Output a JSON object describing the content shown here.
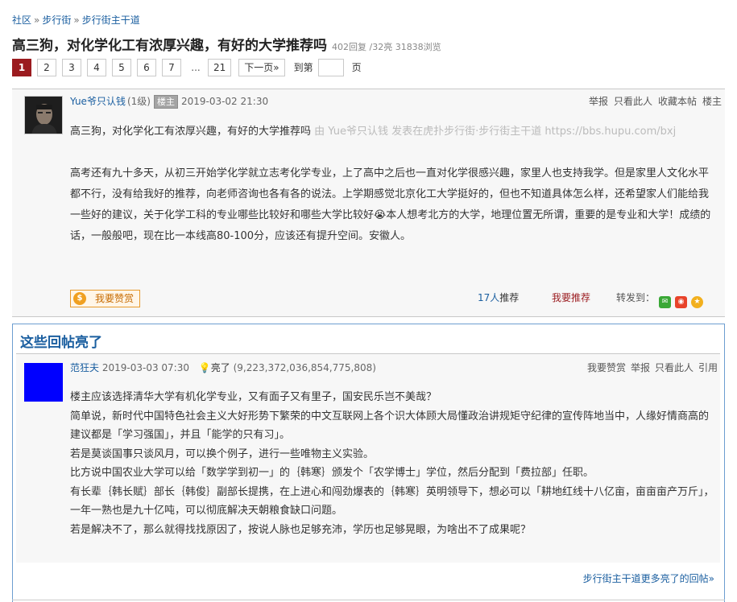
{
  "breadcrumb": {
    "items": [
      "社区",
      "步行街",
      "步行街主干道"
    ],
    "separator": "»"
  },
  "thread": {
    "title": "高三狗，对化学化工有浓厚兴趣，有好的大学推荐吗",
    "stats": "402回复 /32亮  31838浏览"
  },
  "pager": {
    "pages": [
      "1",
      "2",
      "3",
      "4",
      "5",
      "6",
      "7"
    ],
    "ellipsis": "...",
    "last_page": "21",
    "next_label": "下一页»",
    "goto_label": "到第",
    "page_unit": "页",
    "active_page": "1"
  },
  "main_post": {
    "author": "Yue爷只认钱",
    "level": "(1级)",
    "badge": "楼主",
    "time": "2019-03-02 21:30",
    "actions": [
      "举报",
      "只看此人",
      "收藏本帖",
      "楼主"
    ],
    "first_line": "高三狗，对化学化工有浓厚兴趣，有好的大学推荐吗",
    "source_note": "由 Yue爷只认钱 发表在虎扑步行街·步行街主干道 https://bbs.hupu.com/bxj",
    "body": "高考还有九十多天，从初三开始学化学就立志考化学专业，上了高中之后也一直对化学很感兴趣，家里人也支持我学。但是家里人文化水平都不行，没有给我好的推荐，向老师咨询也各有各的说法。上学期感觉北京化工大学挺好的，但也不知道具体怎么样，还希望家人们能给我一些好的建议，关于化学工科的专业哪些比较好和哪些大学比较好😭本人想考北方的大学，地理位置无所谓，重要的是专业和大学！成绩的话，一般般吧，现在比一本线高80-100分，应该还有提升空间。安徽人。",
    "reward_label": "我要赞赏",
    "recommend_count": "17人",
    "recommend_label": "推荐",
    "my_recommend": "我要推荐",
    "share_label": "转发到："
  },
  "lightbox": {
    "heading": "这些回帖亮了",
    "reply": {
      "author": "范狂夫",
      "time": "2019-03-03 07:30",
      "lit_label": "亮了",
      "lit_count": "(9,223,372,036,854,775,808)",
      "actions": [
        "我要赞赏",
        "举报",
        "只看此人",
        "引用"
      ],
      "lines": [
        "楼主应该选择清华大学有机化学专业，又有面子又有里子，国安民乐岂不美哉？",
        "简单说，新时代中国特色社会主义大好形势下繁荣的中文互联网上各个识大体顾大局懂政治讲规矩守纪律的宣传阵地当中，人缘好情商高的建议都是「学习强国」，并且「能学的只有习」。",
        "若是莫谈国事只谈风月，可以换个例子，进行一些唯物主义实验。",
        "比方说中国农业大学可以给「数学学到初一」的｛韩寒｝颁发个「农学博士」学位，然后分配到「费拉部」任职。",
        "有长辈｛韩长赋｝部长｛韩俊｝副部长提携，在上进心和闯劲爆表的｛韩寒｝英明领导下，想必可以「耕地红线十八亿亩，亩亩亩产万斤」，一年一熟也是九十亿吨，可以彻底解决天朝粮食缺口问题。",
        "若是解决不了，那么就得找找原因了，按说人脉也足够充沛，学历也足够晃眼，为啥出不了成果呢？"
      ]
    },
    "more_link": "步行街主干道更多亮了的回帖»"
  },
  "colors": {
    "link_blue": "#1b5fa0",
    "active_page": "#9b1b1f",
    "reply_avatar": "#0000ff"
  }
}
